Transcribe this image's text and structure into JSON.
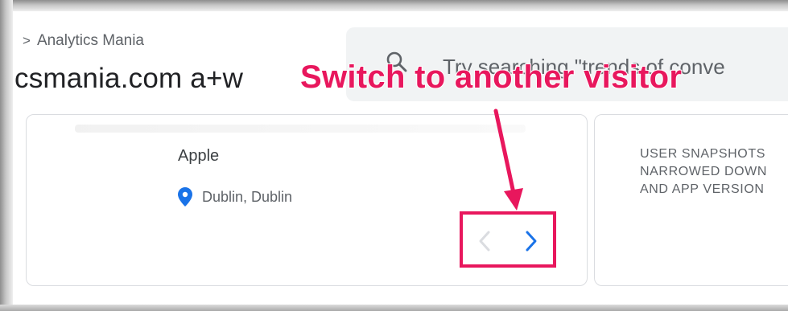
{
  "breadcrumb": {
    "separator": ">",
    "account": "Analytics Mania"
  },
  "property_title": "csmania.com a+w",
  "search": {
    "placeholder": "Try searching \"trends of conve"
  },
  "annotation": {
    "text": "Switch to another visitor",
    "color": "#e8175d"
  },
  "visitor_card": {
    "device_brand": "Apple",
    "location": "Dublin, Dublin",
    "prev_button": "previous-visitor",
    "next_button": "next-visitor"
  },
  "snapshot_card": {
    "lines": [
      "USER SNAPSHOTS",
      "NARROWED DOWN",
      "AND APP VERSION"
    ]
  },
  "colors": {
    "accent_blue": "#1a73e8",
    "annotation_pink": "#e8175d",
    "disabled_gray": "#dadce0"
  },
  "icons": {
    "search": "search-icon",
    "location": "location-pin-icon",
    "prev": "chevron-left-icon",
    "next": "chevron-right-icon"
  }
}
